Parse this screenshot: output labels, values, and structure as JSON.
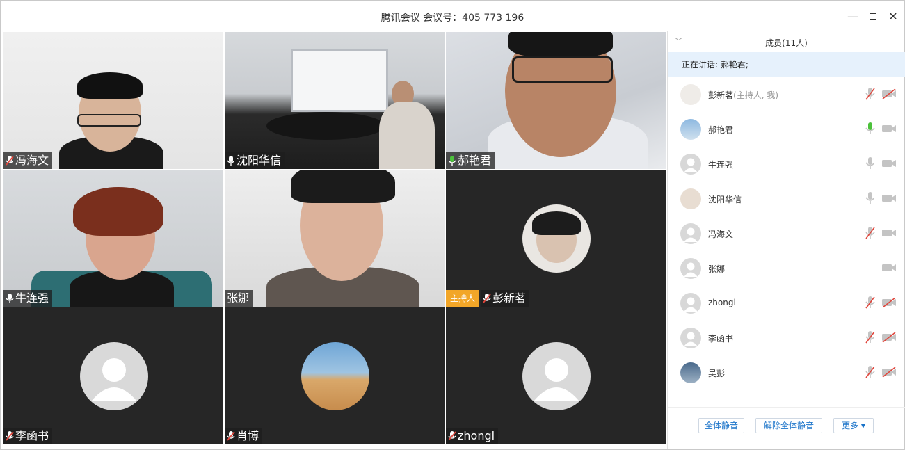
{
  "window": {
    "title": "腾讯会议 会议号：405 773 196"
  },
  "tiles": [
    {
      "name": "冯海文",
      "mic": "muted"
    },
    {
      "name": "沈阳华信",
      "mic": "on"
    },
    {
      "name": "郝艳君",
      "mic": "speaking"
    },
    {
      "name": "牛连强",
      "mic": "on"
    },
    {
      "name": "张娜",
      "mic": "none"
    },
    {
      "name": "彭新茗",
      "mic": "muted",
      "badge": "主持人"
    },
    {
      "name": "李函书",
      "mic": "muted"
    },
    {
      "name": "肖博",
      "mic": "muted"
    },
    {
      "name": "zhongl",
      "mic": "muted"
    }
  ],
  "panel": {
    "title": "成员(11人)",
    "speaking_label": "正在讲话: 郝艳君;",
    "members": [
      {
        "name": "彭新茗",
        "suffix": "(主持人, 我)",
        "mic": "muted",
        "cam": "off"
      },
      {
        "name": "郝艳君",
        "suffix": "",
        "mic": "speaking",
        "cam": "on"
      },
      {
        "name": "牛连强",
        "suffix": "",
        "mic": "on",
        "cam": "on"
      },
      {
        "name": "沈阳华信",
        "suffix": "",
        "mic": "on",
        "cam": "on"
      },
      {
        "name": "冯海文",
        "suffix": "",
        "mic": "muted",
        "cam": "on"
      },
      {
        "name": "张娜",
        "suffix": "",
        "mic": "none",
        "cam": "on"
      },
      {
        "name": "zhongl",
        "suffix": "",
        "mic": "muted",
        "cam": "off"
      },
      {
        "name": "李函书",
        "suffix": "",
        "mic": "muted",
        "cam": "off"
      },
      {
        "name": "吴彭",
        "suffix": "",
        "mic": "muted",
        "cam": "off"
      }
    ],
    "buttons": {
      "mute_all": "全体静音",
      "unmute_all": "解除全体静音",
      "more": "更多 ▾"
    }
  },
  "colors": {
    "speaking": "#4cc13b",
    "muted": "#e0463c",
    "host_badge": "#f2a628",
    "accent": "#1a73c9"
  }
}
